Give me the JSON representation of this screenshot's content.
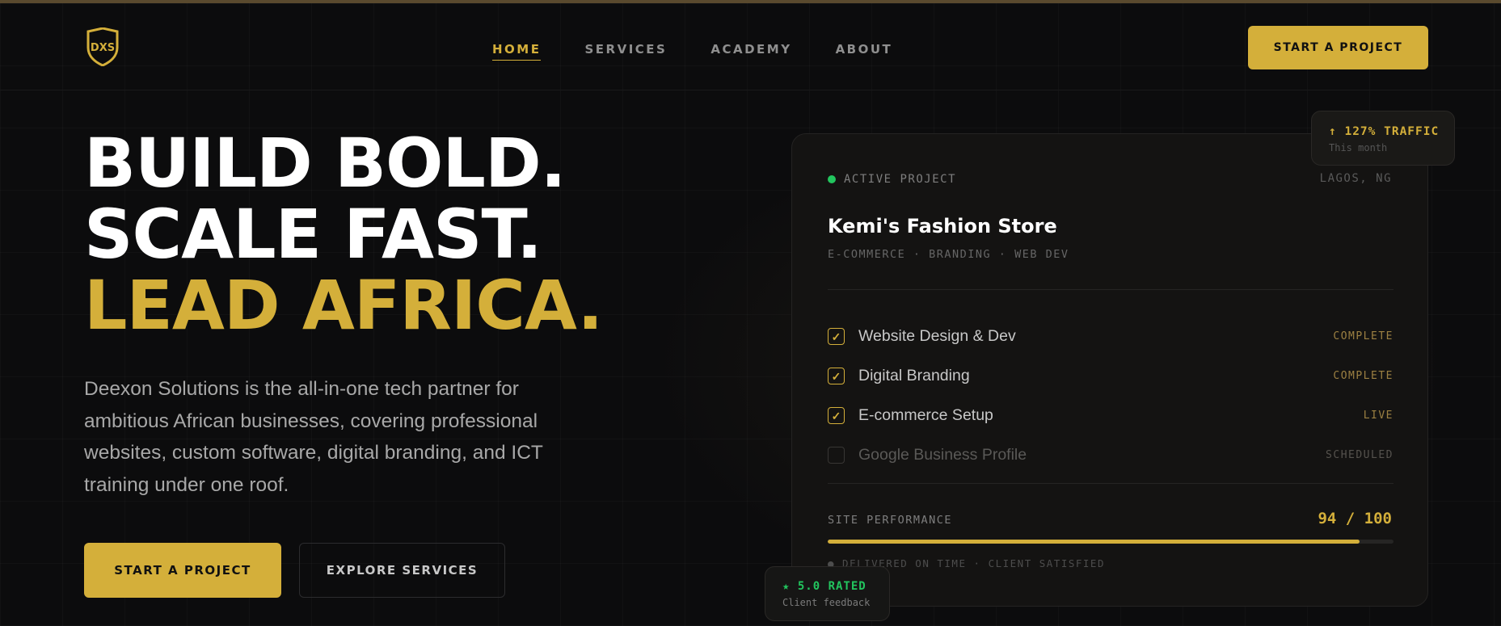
{
  "colors": {
    "accent": "#d4af3a",
    "background": "#0c0c0d",
    "active_green": "#22c55e"
  },
  "logo": {
    "icon": "shield-logo-icon",
    "text": "DXS"
  },
  "nav": {
    "items": [
      {
        "label": "HOME",
        "active": true
      },
      {
        "label": "SERVICES",
        "active": false
      },
      {
        "label": "ACADEMY",
        "active": false
      },
      {
        "label": "ABOUT",
        "active": false
      }
    ]
  },
  "header": {
    "cta_label": "START A PROJECT"
  },
  "hero": {
    "line1": "BUILD BOLD.",
    "line2": "SCALE FAST.",
    "line3": "LEAD AFRICA.",
    "description": "Deexon Solutions is the all-in-one tech partner for ambitious African businesses, covering professional websites, custom software, digital branding, and ICT training under one roof.",
    "primary_cta": "START A PROJECT",
    "secondary_cta": "EXPLORE SERVICES"
  },
  "project_card": {
    "status": "ACTIVE PROJECT",
    "location": "LAGOS, NG",
    "title": "Kemi's Fashion Store",
    "tags": "E-COMMERCE · BRANDING · WEB DEV",
    "tasks": [
      {
        "label": "Website Design & Dev",
        "status": "COMPLETE",
        "checked": true
      },
      {
        "label": "Digital Branding",
        "status": "COMPLETE",
        "checked": true
      },
      {
        "label": "E-commerce Setup",
        "status": "LIVE",
        "checked": true
      },
      {
        "label": "Google Business Profile",
        "status": "SCHEDULED",
        "checked": false
      }
    ],
    "performance_label": "SITE PERFORMANCE",
    "performance_value": "94 / 100",
    "performance_score": 94,
    "delivered_text": "● DELIVERED ON TIME · CLIENT SATISFIED"
  },
  "traffic_badge": {
    "main": "↑ 127% TRAFFIC",
    "sub": "This month"
  },
  "rating_badge": {
    "main": "★ 5.0 RATED",
    "sub": "Client feedback"
  }
}
